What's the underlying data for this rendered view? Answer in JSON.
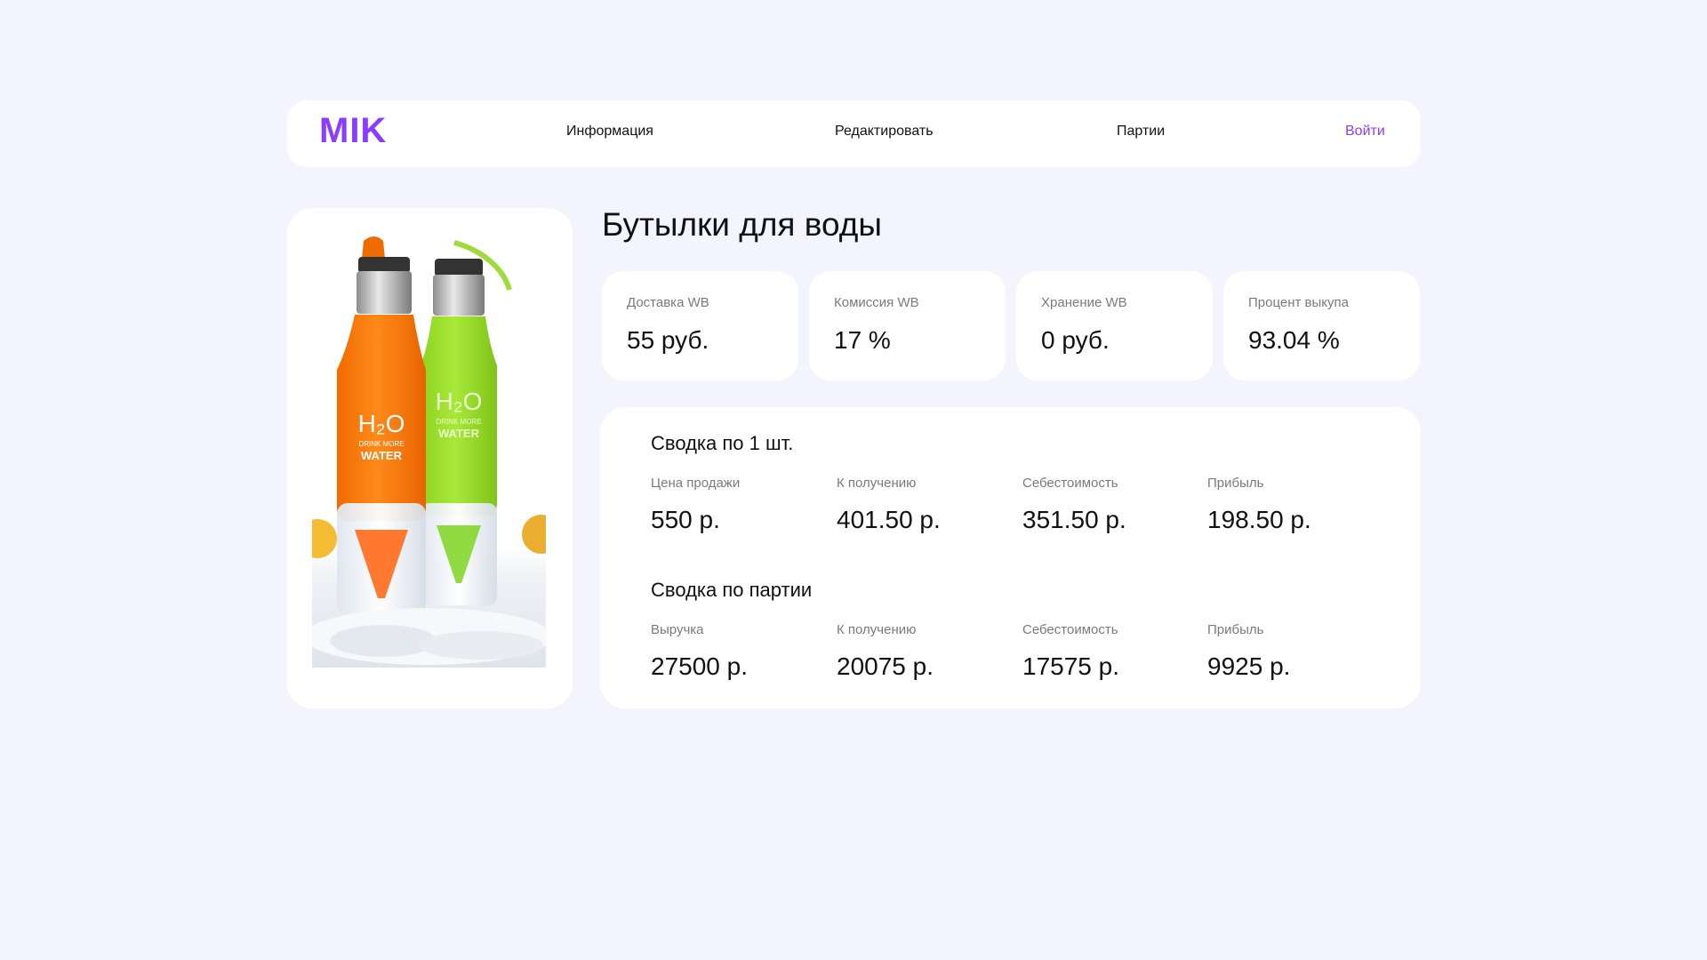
{
  "header": {
    "logo": "MIK",
    "nav": {
      "info": "Информация",
      "edit": "Редактировать",
      "batches": "Партии",
      "login": "Войти"
    }
  },
  "product": {
    "title": "Бутылки для воды"
  },
  "stats": [
    {
      "label": "Доставка WB",
      "value": "55 руб."
    },
    {
      "label": "Комиссия WB",
      "value": "17 %"
    },
    {
      "label": "Хранение WB",
      "value": "0 руб."
    },
    {
      "label": "Процент выкупа",
      "value": "93.04 %"
    }
  ],
  "summary_unit": {
    "title": "Сводка по 1 шт.",
    "metrics": [
      {
        "label": "Цена продажи",
        "value": "550 р."
      },
      {
        "label": "К получению",
        "value": "401.50 р."
      },
      {
        "label": "Себестоимость",
        "value": "351.50 р."
      },
      {
        "label": "Прибыль",
        "value": "198.50 р."
      }
    ]
  },
  "summary_batch": {
    "title": "Сводка по партии",
    "metrics": [
      {
        "label": "Выручка",
        "value": "27500 р."
      },
      {
        "label": "К получению",
        "value": "20075 р."
      },
      {
        "label": "Себестоимость",
        "value": "17575 р."
      },
      {
        "label": "Прибыль",
        "value": "9925 р."
      }
    ]
  },
  "image": {
    "bottle1_text": {
      "big": "H₂O",
      "small": "DRINK MORE",
      "bottom": "WATER"
    },
    "bottle2_text": {
      "big": "H₂O",
      "small": "DRINK MORE",
      "bottom": "WATER"
    }
  },
  "colors": {
    "background": "#f3f4fd",
    "card": "#ffffff",
    "accent": "#8b3dff",
    "label_gray": "#7a7a7a",
    "text": "#111111"
  }
}
